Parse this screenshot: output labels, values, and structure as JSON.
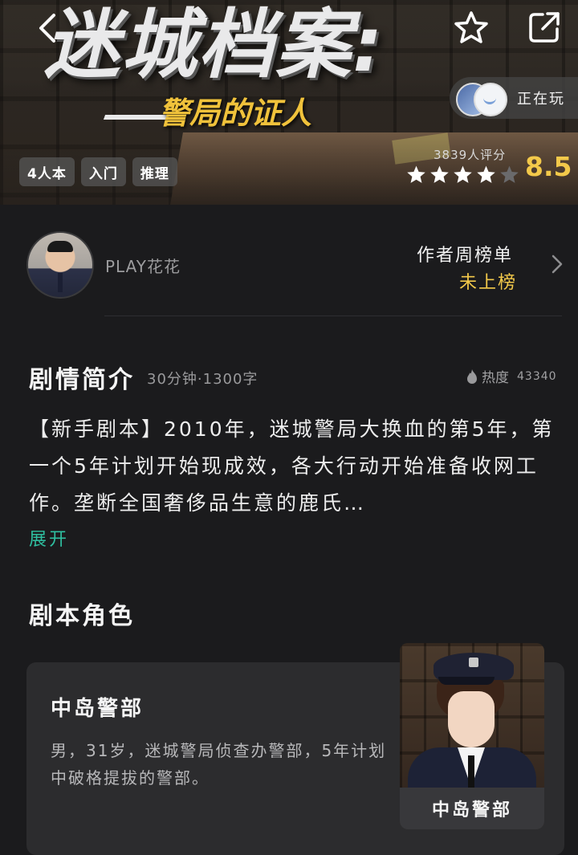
{
  "banner": {
    "title_main": "迷城档案:",
    "title_sub": "警局的证人",
    "tags": [
      "4人本",
      "入门",
      "推理"
    ],
    "rating_count": "3839人评分",
    "score": "8.5",
    "stars_filled": 4,
    "stars_total": 5,
    "playing_label": "正在玩"
  },
  "author": {
    "name": "PLAY花花",
    "rank_title": "作者周榜单",
    "rank_value": "未上榜"
  },
  "synopsis": {
    "title": "剧情简介",
    "meta": "30分钟·1300字",
    "heat_label": "热度",
    "heat_value": "43340",
    "text": "【新手剧本】2010年，迷城警局大换血的第5年，第一个5年计划开始现成效，各大行动开始准备收网工作。垄断全国奢侈品生意的鹿氏…",
    "expand_label": "展开"
  },
  "roles": {
    "title": "剧本角色",
    "items": [
      {
        "name": "中岛警部",
        "description": "男，31岁，迷城警局侦查办警部，5年计划中破格提拔的警部。",
        "portrait_label": "中岛警部"
      }
    ]
  },
  "colors": {
    "accent_gold": "#f3c94a",
    "expand_green": "#2fbfa0",
    "background": "#1b1b1d"
  }
}
